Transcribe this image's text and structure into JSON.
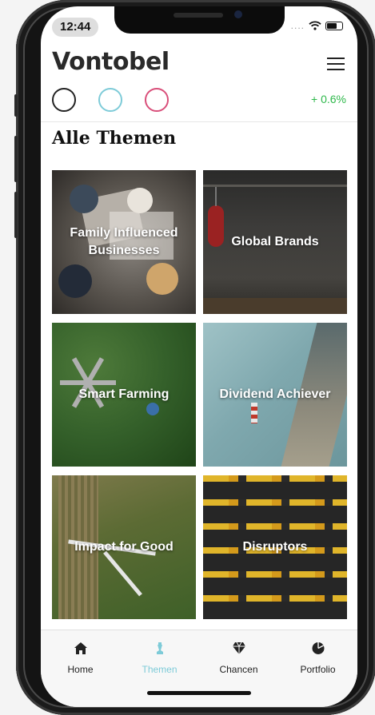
{
  "status": {
    "time": "12:44",
    "signal_dots": "...."
  },
  "header": {
    "logo": "Vontobel",
    "performance": "+ 0.6%",
    "circle_colors": [
      "#222222",
      "#7ecbd8",
      "#d94f7a"
    ]
  },
  "section": {
    "title": "Alle Themen"
  },
  "themes": [
    {
      "label": "Family Influenced Businesses"
    },
    {
      "label": "Global Brands"
    },
    {
      "label": "Smart Farming"
    },
    {
      "label": "Dividend Achiever"
    },
    {
      "label": "Impact for Good"
    },
    {
      "label": "Disruptors"
    }
  ],
  "tabs": [
    {
      "label": "Home",
      "icon": "house-icon"
    },
    {
      "label": "Themen",
      "icon": "chess-piece-icon",
      "active": true
    },
    {
      "label": "Chancen",
      "icon": "diamond-icon"
    },
    {
      "label": "Portfolio",
      "icon": "pie-chart-icon"
    }
  ],
  "colors": {
    "accent": "#7ecbd8",
    "positive": "#2db84a"
  }
}
